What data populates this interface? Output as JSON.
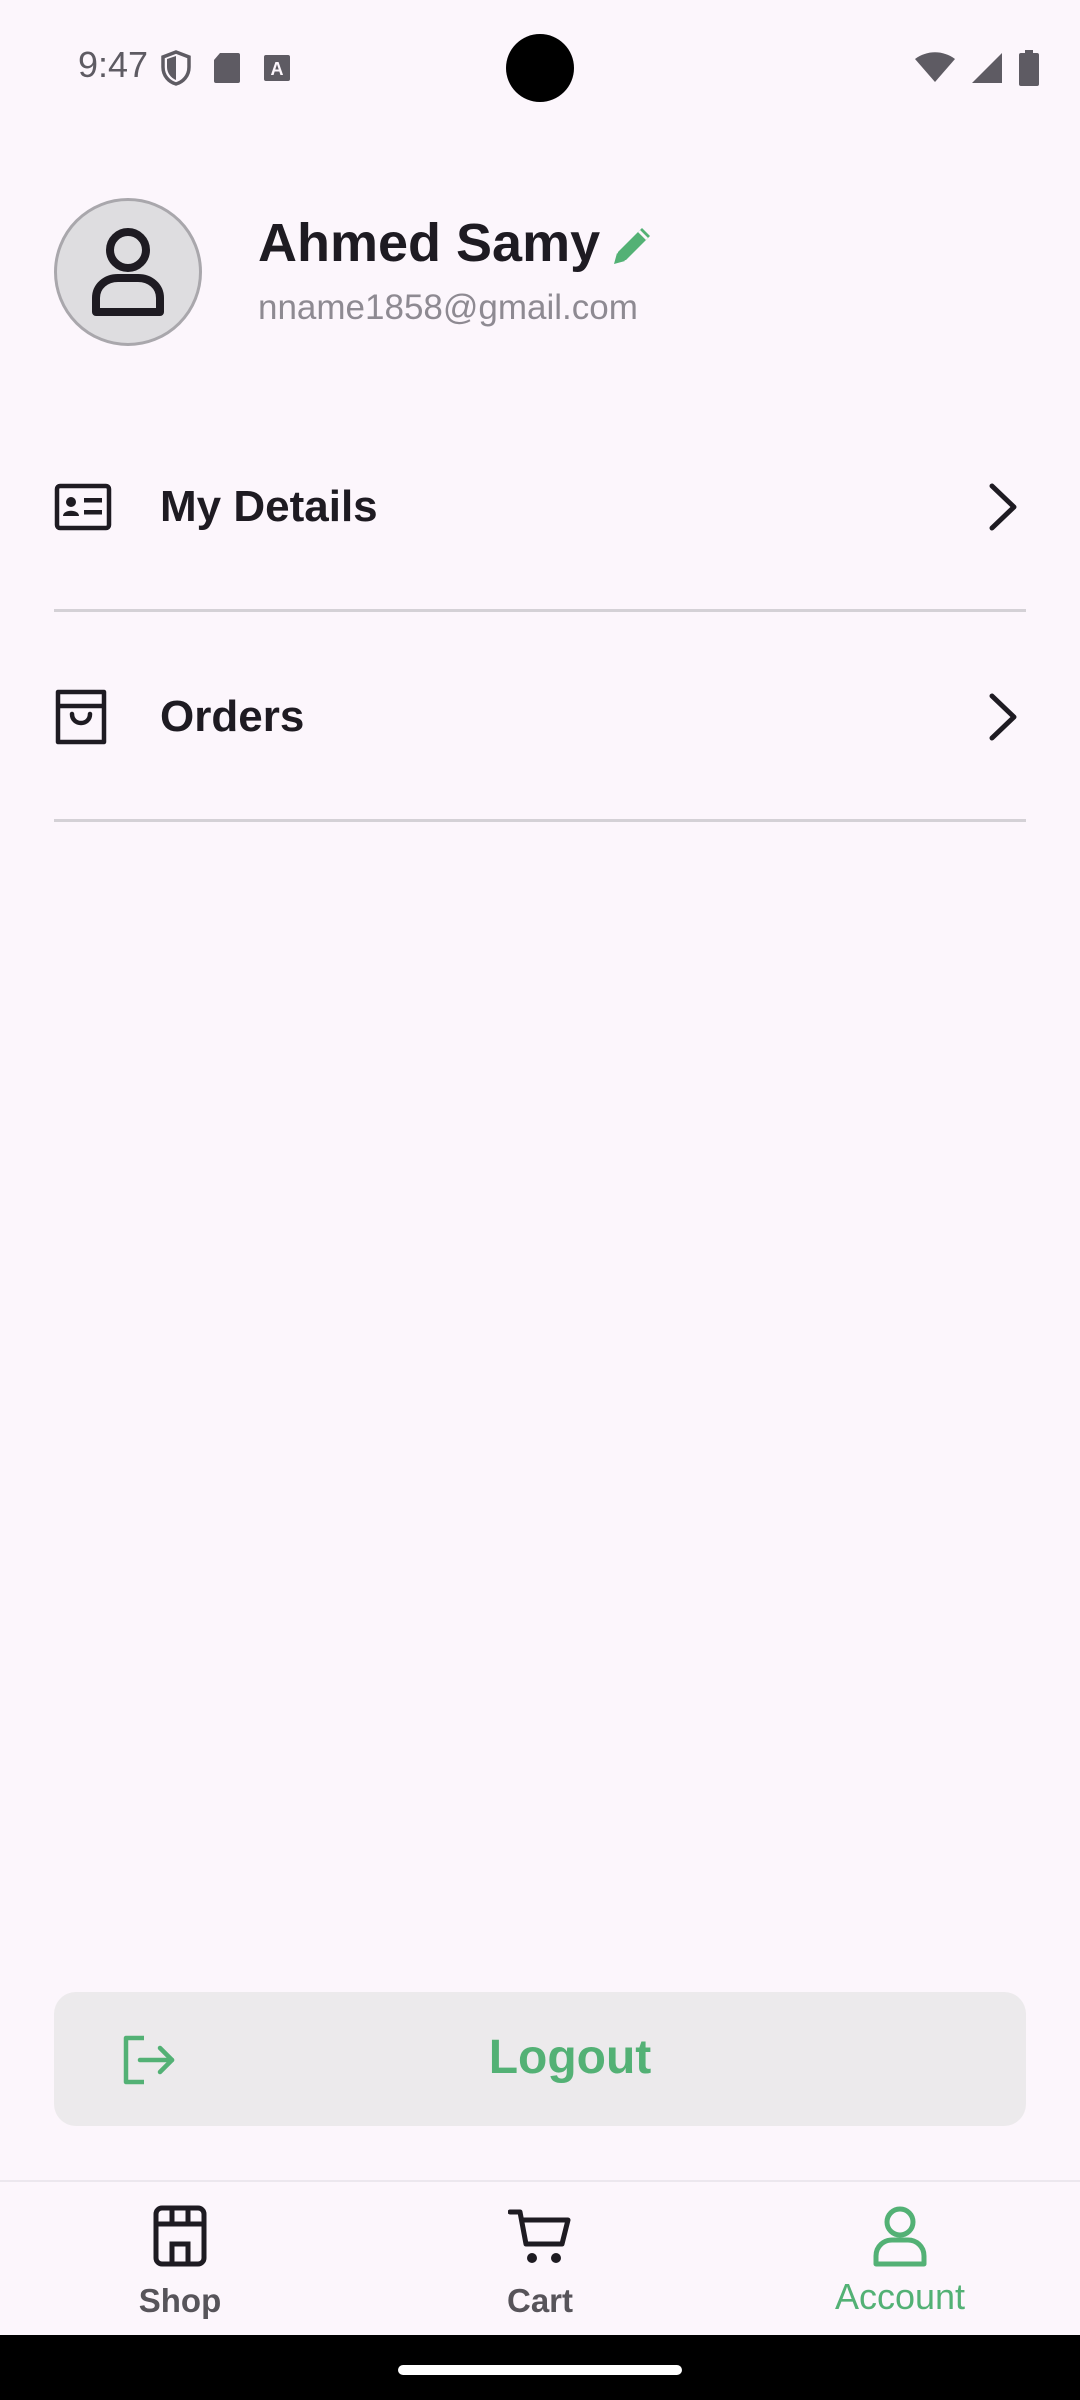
{
  "status_bar": {
    "time": "9:47"
  },
  "profile": {
    "name": "Ahmed Samy",
    "email": "nname1858@gmail.com"
  },
  "menu": [
    {
      "label": "My Details",
      "icon": "id-card-icon"
    },
    {
      "label": "Orders",
      "icon": "shopping-bag-icon"
    }
  ],
  "logout": {
    "label": "Logout"
  },
  "bottom_nav": {
    "items": [
      {
        "label": "Shop",
        "icon": "store-icon"
      },
      {
        "label": "Cart",
        "icon": "cart-icon"
      },
      {
        "label": "Account",
        "icon": "account-icon",
        "active": true
      }
    ]
  },
  "colors": {
    "accent": "#53B175",
    "background": "#FCF6FC",
    "text": "#1E1B22",
    "muted": "#8E8A92"
  }
}
